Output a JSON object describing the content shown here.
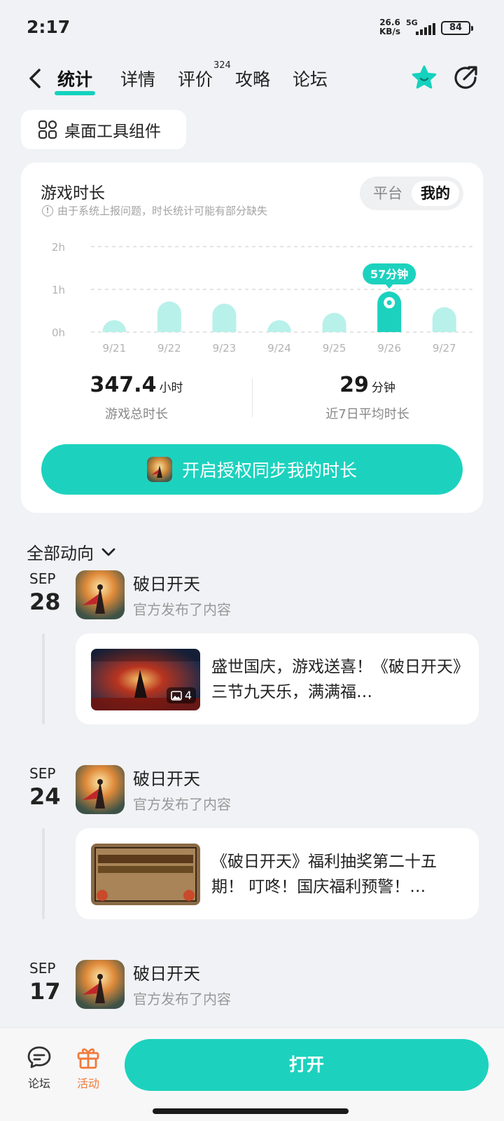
{
  "status": {
    "time": "2:17",
    "speed_value": "26.6",
    "speed_unit": "KB/s",
    "network": "5G",
    "battery": "84"
  },
  "nav": {
    "tabs": [
      {
        "label": "统计",
        "active": true
      },
      {
        "label": "详情"
      },
      {
        "label": "评价"
      },
      {
        "label": "攻略"
      },
      {
        "label": "论坛"
      }
    ],
    "review_count": "324"
  },
  "widget_button": {
    "label": "桌面工具组件"
  },
  "stats_card": {
    "title": "游戏时长",
    "hint": "由于系统上报问题，时长统计可能有部分缺失",
    "toggle": {
      "platform": "平台",
      "mine": "我的"
    },
    "total": {
      "value": "347.4",
      "unit": "小时",
      "caption": "游戏总时长"
    },
    "average": {
      "value": "29",
      "unit": "分钟",
      "caption": "近7日平均时长"
    },
    "sync_button": "开启授权同步我的时长",
    "colors": {
      "accent": "#1cd2be",
      "bar": "#b8f1ea"
    }
  },
  "chart_data": {
    "type": "bar",
    "categories": [
      "9/21",
      "9/22",
      "9/23",
      "9/24",
      "9/25",
      "9/26",
      "9/27"
    ],
    "values": [
      5,
      43,
      40,
      5,
      27,
      57,
      35
    ],
    "ylim": [
      0,
      120
    ],
    "yticks": [
      {
        "value": 0,
        "label": "0h"
      },
      {
        "value": 60,
        "label": "1h"
      },
      {
        "value": 120,
        "label": "2h"
      }
    ],
    "highlight_index": 5,
    "highlight_label": "57分钟",
    "grid": true
  },
  "feed": {
    "header": "全部动向",
    "entries": [
      {
        "month": "SEP",
        "day": "28",
        "game": "破日开天",
        "action": "官方发布了内容",
        "post_text": "盛世国庆，游戏送喜！《破日开天》三节九天乐，满满福…",
        "image_count": "4"
      },
      {
        "month": "SEP",
        "day": "24",
        "game": "破日开天",
        "action": "官方发布了内容",
        "post_text": "《破日开天》福利抽奖第二十五期！ 叮咚！国庆福利预警！…"
      },
      {
        "month": "SEP",
        "day": "17",
        "game": "破日开天",
        "action": "官方发布了内容"
      }
    ]
  },
  "bottom_bar": {
    "forum": "论坛",
    "events": "活动",
    "open": "打开"
  }
}
